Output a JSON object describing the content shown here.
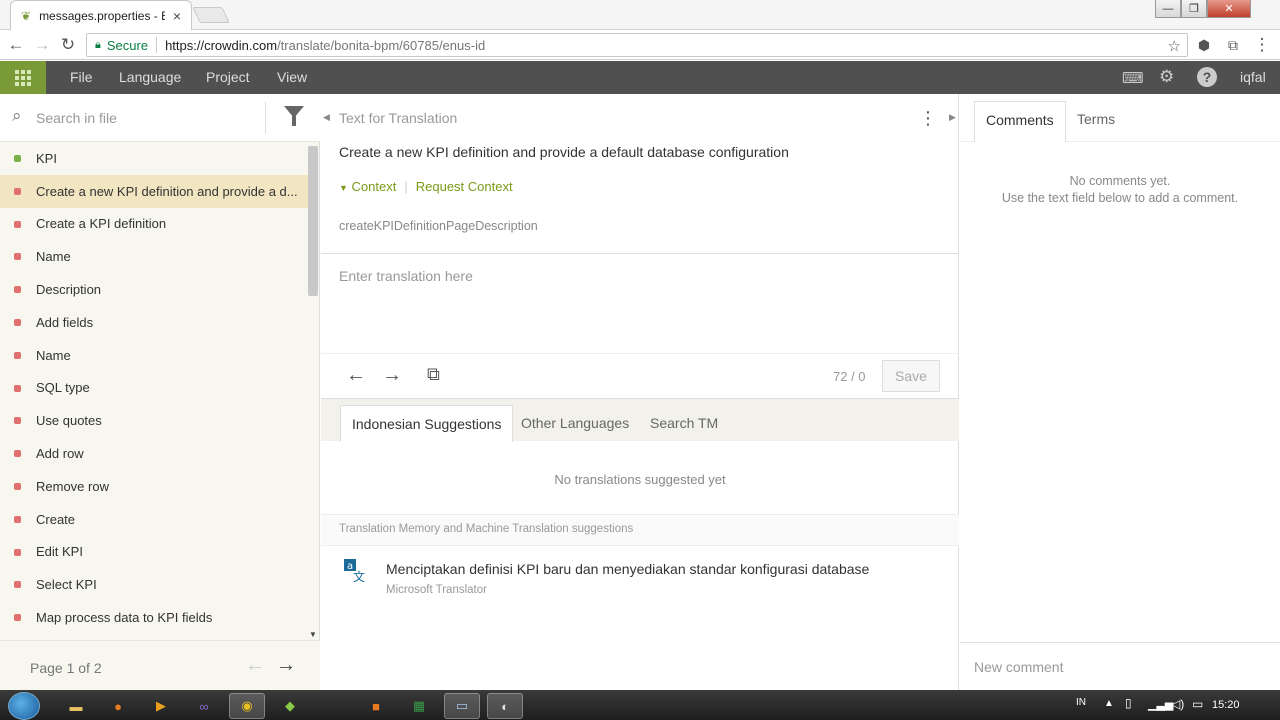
{
  "browser": {
    "tab_title": "messages.properties - Bonita",
    "tab_close": "×",
    "secure_label": "Secure",
    "url_host": "https://crowdin.com",
    "url_path": "/translate/bonita-bpm/60785/enus-id",
    "window_buttons": [
      "—",
      "❐",
      "✕"
    ]
  },
  "appbar": {
    "menu": [
      "File",
      "Language",
      "Project",
      "View"
    ],
    "user": "iqfal"
  },
  "left": {
    "search_placeholder": "Search in file",
    "items": [
      {
        "label": "KPI",
        "status": "green"
      },
      {
        "label": "Create a new KPI definition and provide a d...",
        "status": "red",
        "active": true
      },
      {
        "label": "Create a KPI definition",
        "status": "red"
      },
      {
        "label": "Name",
        "status": "red"
      },
      {
        "label": "Description",
        "status": "red"
      },
      {
        "label": "Add fields",
        "status": "red"
      },
      {
        "label": "Name",
        "status": "red"
      },
      {
        "label": "SQL type",
        "status": "red"
      },
      {
        "label": "Use quotes",
        "status": "red"
      },
      {
        "label": "Add row",
        "status": "red"
      },
      {
        "label": "Remove row",
        "status": "red"
      },
      {
        "label": "Create",
        "status": "red"
      },
      {
        "label": "Edit KPI",
        "status": "red"
      },
      {
        "label": "Select KPI",
        "status": "red"
      },
      {
        "label": "Map process data to KPI fields",
        "status": "red"
      }
    ],
    "pager_text": "Page 1 of 2"
  },
  "center": {
    "header": "Text for Translation",
    "source_text": "Create a new KPI definition and provide a default database configuration",
    "context_label": "Context",
    "request_context_label": "Request Context",
    "string_key": "createKPIDefinitionPageDescription",
    "translation_placeholder": "Enter translation here",
    "counter": "72 / 0",
    "save_label": "Save",
    "tabs": [
      "Indonesian Suggestions",
      "Other Languages",
      "Search TM"
    ],
    "no_suggestions": "No translations suggested yet",
    "tm_header": "Translation Memory and Machine Translation suggestions",
    "mt_suggestion": "Menciptakan definisi KPI baru dan menyediakan standar konfigurasi database",
    "mt_source": "Microsoft Translator"
  },
  "right": {
    "tabs": [
      "Comments",
      "Terms"
    ],
    "no_comments_line1": "No comments yet.",
    "no_comments_line2": "Use the text field below to add a comment.",
    "new_comment_placeholder": "New comment"
  },
  "taskbar": {
    "language": "IN",
    "time": "15:20"
  },
  "colors": {
    "accent_green": "#7a9a38",
    "appbar": "#505050",
    "active_row": "#f2e6c2",
    "untranslated_dot": "#e07070",
    "translated_dot": "#77b349"
  }
}
